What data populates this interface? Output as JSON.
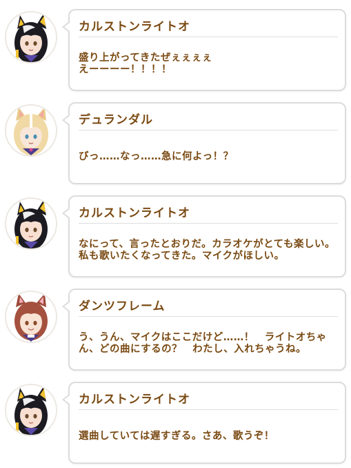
{
  "messages": [
    {
      "speaker": "カルストンライトオ",
      "text": "盛り上がってきたぜぇぇぇぇ\nえーーーー！！！！",
      "avatar_icon": "dark-haired-character-avatar"
    },
    {
      "speaker": "デュランダル",
      "text": "びっ……なっ……急に何よっ！？",
      "avatar_icon": "blonde-character-avatar"
    },
    {
      "speaker": "カルストンライトオ",
      "text": "なにって、言ったとおりだ。カラオケがとても楽しい。私も歌いたくなってきた。マイクがほしい。",
      "avatar_icon": "dark-haired-character-avatar"
    },
    {
      "speaker": "ダンツフレーム",
      "text": "う、うん、マイクはここだけど……！　ライトオちゃん、どの曲にするの？　わたし、入れちゃうね。",
      "avatar_icon": "red-haired-character-avatar"
    },
    {
      "speaker": "カルストンライトオ",
      "text": "選曲していては遅すぎる。さあ、歌うぞ！",
      "avatar_icon": "dark-haired-character-avatar"
    }
  ]
}
